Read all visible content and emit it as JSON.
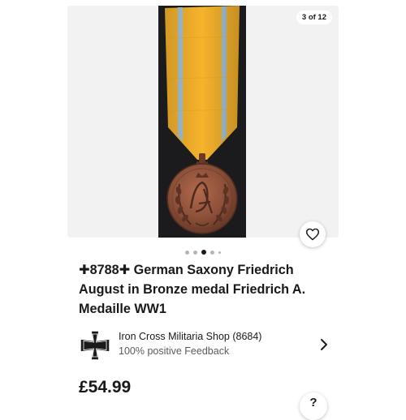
{
  "gallery": {
    "counter": "3 of 12",
    "image_alt": "Saxony Friedrich August bronze medal with yellow and blue ribbon",
    "dots_total": 5,
    "dots_active_index": 2
  },
  "listing": {
    "title": "✚8788✚ German Saxony Friedrich August in Bronze medal Friedrich A. Medaille WW1",
    "price": "£54.99"
  },
  "seller": {
    "name": "Iron Cross Militaria Shop (8684)",
    "feedback": "100% positive Feedback",
    "logo_icon": "iron-cross-icon"
  },
  "icons": {
    "favorite": "heart-icon",
    "chevron": "chevron-right-icon",
    "help": "help-icon"
  },
  "help": {
    "label": "?"
  },
  "colors": {
    "ribbon_yellow": "#f6b32c",
    "ribbon_blue": "#9ec3dd",
    "bronze": "#8b4f38",
    "text": "#191919",
    "muted": "#5b5b5b"
  }
}
